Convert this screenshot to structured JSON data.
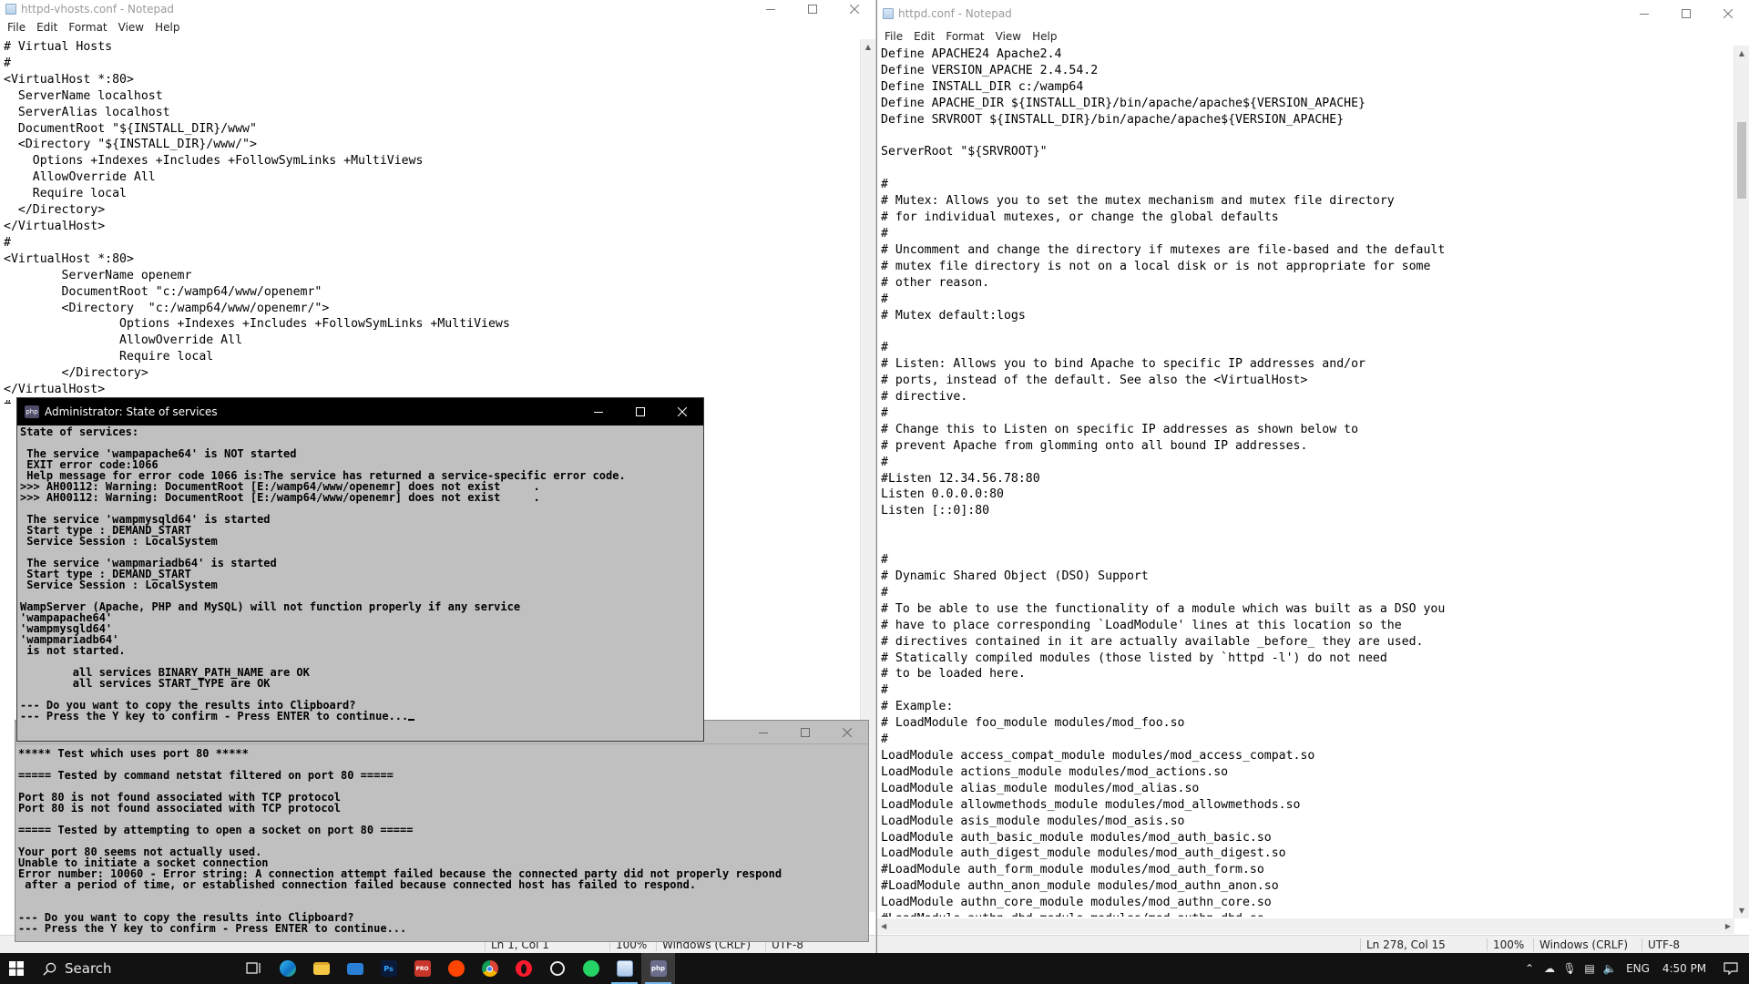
{
  "left_notepad": {
    "title": "httpd-vhosts.conf - Notepad",
    "menu": [
      "File",
      "Edit",
      "Format",
      "View",
      "Help"
    ],
    "lines": [
      "# Virtual Hosts",
      "#",
      "<VirtualHost *:80>",
      "  ServerName localhost",
      "  ServerAlias localhost",
      "  DocumentRoot \"${INSTALL_DIR}/www\"",
      "  <Directory \"${INSTALL_DIR}/www/\">",
      "    Options +Indexes +Includes +FollowSymLinks +MultiViews",
      "    AllowOverride All",
      "    Require local",
      "  </Directory>",
      "</VirtualHost>",
      "#",
      "<VirtualHost *:80>",
      "        ServerName openemr",
      "        DocumentRoot \"c:/wamp64/www/openemr\"",
      "        <Directory  \"c:/wamp64/www/openemr/\">",
      "                Options +Indexes +Includes +FollowSymLinks +MultiViews",
      "                AllowOverride All",
      "                Require local",
      "        </Directory>",
      "</VirtualHost>",
      "#"
    ],
    "status": {
      "position": "Ln 1, Col 1",
      "zoom": "100%",
      "line_ending": "Windows (CRLF)",
      "encoding": "UTF-8"
    }
  },
  "right_notepad": {
    "title": "httpd.conf - Notepad",
    "menu": [
      "File",
      "Edit",
      "Format",
      "View",
      "Help"
    ],
    "lines": [
      "Define APACHE24 Apache2.4",
      "Define VERSION_APACHE 2.4.54.2",
      "Define INSTALL_DIR c:/wamp64",
      "Define APACHE_DIR ${INSTALL_DIR}/bin/apache/apache${VERSION_APACHE}",
      "Define SRVROOT ${INSTALL_DIR}/bin/apache/apache${VERSION_APACHE}",
      "",
      "ServerRoot \"${SRVROOT}\"",
      "",
      "#",
      "# Mutex: Allows you to set the mutex mechanism and mutex file directory",
      "# for individual mutexes, or change the global defaults",
      "#",
      "# Uncomment and change the directory if mutexes are file-based and the default",
      "# mutex file directory is not on a local disk or is not appropriate for some",
      "# other reason.",
      "#",
      "# Mutex default:logs",
      "",
      "#",
      "# Listen: Allows you to bind Apache to specific IP addresses and/or",
      "# ports, instead of the default. See also the <VirtualHost>",
      "# directive.",
      "#",
      "# Change this to Listen on specific IP addresses as shown below to",
      "# prevent Apache from glomming onto all bound IP addresses.",
      "#",
      "#Listen 12.34.56.78:80",
      "Listen 0.0.0.0:80",
      "Listen [::0]:80",
      "",
      "",
      "#",
      "# Dynamic Shared Object (DSO) Support",
      "#",
      "# To be able to use the functionality of a module which was built as a DSO you",
      "# have to place corresponding `LoadModule' lines at this location so the",
      "# directives contained in it are actually available _before_ they are used.",
      "# Statically compiled modules (those listed by `httpd -l') do not need",
      "# to be loaded here.",
      "#",
      "# Example:",
      "# LoadModule foo_module modules/mod_foo.so",
      "#",
      "LoadModule access_compat_module modules/mod_access_compat.so",
      "LoadModule actions_module modules/mod_actions.so",
      "LoadModule alias_module modules/mod_alias.so",
      "LoadModule allowmethods_module modules/mod_allowmethods.so",
      "LoadModule asis_module modules/mod_asis.so",
      "LoadModule auth_basic_module modules/mod_auth_basic.so",
      "LoadModule auth_digest_module modules/mod_auth_digest.so",
      "#LoadModule auth_form_module modules/mod_auth_form.so",
      "#LoadModule authn_anon_module modules/mod_authn_anon.so",
      "LoadModule authn_core_module modules/mod_authn_core.so",
      "#LoadModule authn_dbd_module modules/mod_authn_dbd.so"
    ],
    "status": {
      "position": "Ln 278, Col 15",
      "zoom": "100%",
      "line_ending": "Windows (CRLF)",
      "encoding": "UTF-8"
    }
  },
  "state_console": {
    "title": "Administrator:  State of services",
    "lines": [
      "State of services:",
      "",
      " The service 'wampapache64' is NOT started",
      " EXIT error code:1066",
      " Help message for error code 1066 is:The service has returned a service-specific error code.",
      ">>> AH00112: Warning: DocumentRoot [E:/wamp64/www/openemr] does not exist     .",
      ">>> AH00112: Warning: DocumentRoot [E:/wamp64/www/openemr] does not exist     .",
      "",
      " The service 'wampmysqld64' is started",
      " Start type : DEMAND_START",
      " Service Session : LocalSystem",
      "",
      " The service 'wampmariadb64' is started",
      " Start type : DEMAND_START",
      " Service Session : LocalSystem",
      "",
      "WampServer (Apache, PHP and MySQL) will not function properly if any service",
      "'wampapache64'",
      "'wampmysqld64'",
      "'wampmariadb64'",
      " is not started.",
      "",
      "        all services BINARY_PATH_NAME are OK",
      "        all services START_TYPE are OK",
      "",
      "--- Do you want to copy the results into Clipboard?",
      "--- Press the Y key to confirm - Press ENTER to continue..."
    ]
  },
  "port_console": {
    "lines": [
      "***** Test which uses port 80 *****",
      "",
      "===== Tested by command netstat filtered on port 80 =====",
      "",
      "Port 80 is not found associated with TCP protocol",
      "Port 80 is not found associated with TCP protocol",
      "",
      "===== Tested by attempting to open a socket on port 80 =====",
      "",
      "Your port 80 seems not actually used.",
      "Unable to initiate a socket connection",
      "Error number: 10060 - Error string: A connection attempt failed because the connected party did not properly respond",
      " after a period of time, or established connection failed because connected host has failed to respond.",
      "",
      "",
      "--- Do you want to copy the results into Clipboard?",
      "--- Press the Y key to confirm - Press ENTER to continue..."
    ]
  },
  "taskbar": {
    "search_label": "Search",
    "apps": [
      "task-view",
      "edge",
      "file-explorer",
      "mail",
      "photoshop",
      "app-red",
      "reddit",
      "chrome",
      "opera",
      "steam",
      "whatsapp",
      "notepad",
      "wampserver-console"
    ],
    "language": "ENG",
    "time": "4:50 PM",
    "accent": "#76b9ed"
  }
}
